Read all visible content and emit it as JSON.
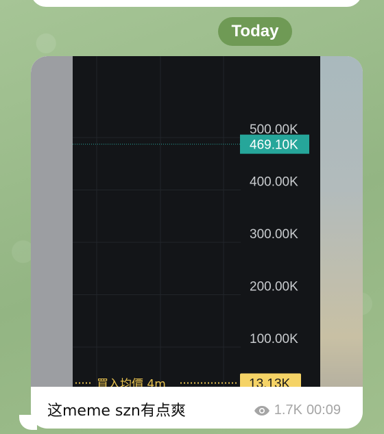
{
  "date_separator": "Today",
  "message": {
    "caption": "这meme szn有点爽",
    "views": "1.7K",
    "time": "00:09",
    "view_icon": "eye-icon"
  },
  "colors": {
    "date_pill": "#6f9a55",
    "price_badge": "#26a69a",
    "avg_badge": "#f5d366",
    "chart_bg": "#131518",
    "axis_text": "#c9cccf"
  },
  "chart_data": {
    "type": "line",
    "title": "",
    "xlabel": "",
    "ylabel": "",
    "ylim": [
      0,
      500000
    ],
    "y_tick_labels": [
      "500.00K",
      "400.00K",
      "300.00K",
      "200.00K",
      "100.00K"
    ],
    "y_ticks": [
      500000,
      400000,
      300000,
      200000,
      100000
    ],
    "current_price": {
      "value": 469100,
      "label": "469.10K"
    },
    "avg_buy": {
      "value": 13130,
      "label": "13.13K",
      "text": "買入均價 4m"
    },
    "grid": true,
    "series": []
  }
}
